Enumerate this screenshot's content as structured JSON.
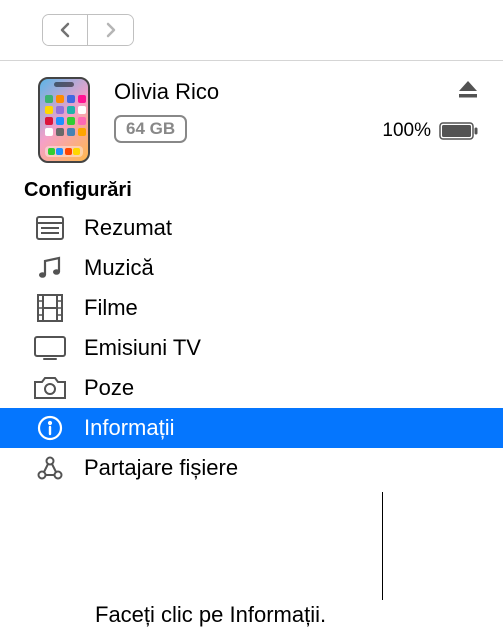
{
  "device": {
    "name": "Olivia Rico",
    "storage": "64 GB",
    "battery_pct": "100%"
  },
  "sidebar": {
    "heading": "Configurări",
    "items": [
      {
        "label": "Rezumat",
        "icon": "summary"
      },
      {
        "label": "Muzică",
        "icon": "music"
      },
      {
        "label": "Filme",
        "icon": "film"
      },
      {
        "label": "Emisiuni TV",
        "icon": "tv"
      },
      {
        "label": "Poze",
        "icon": "camera"
      },
      {
        "label": "Informații",
        "icon": "info",
        "selected": true
      },
      {
        "label": "Partajare fișiere",
        "icon": "apps"
      }
    ]
  },
  "callout": "Faceți clic pe Informații."
}
